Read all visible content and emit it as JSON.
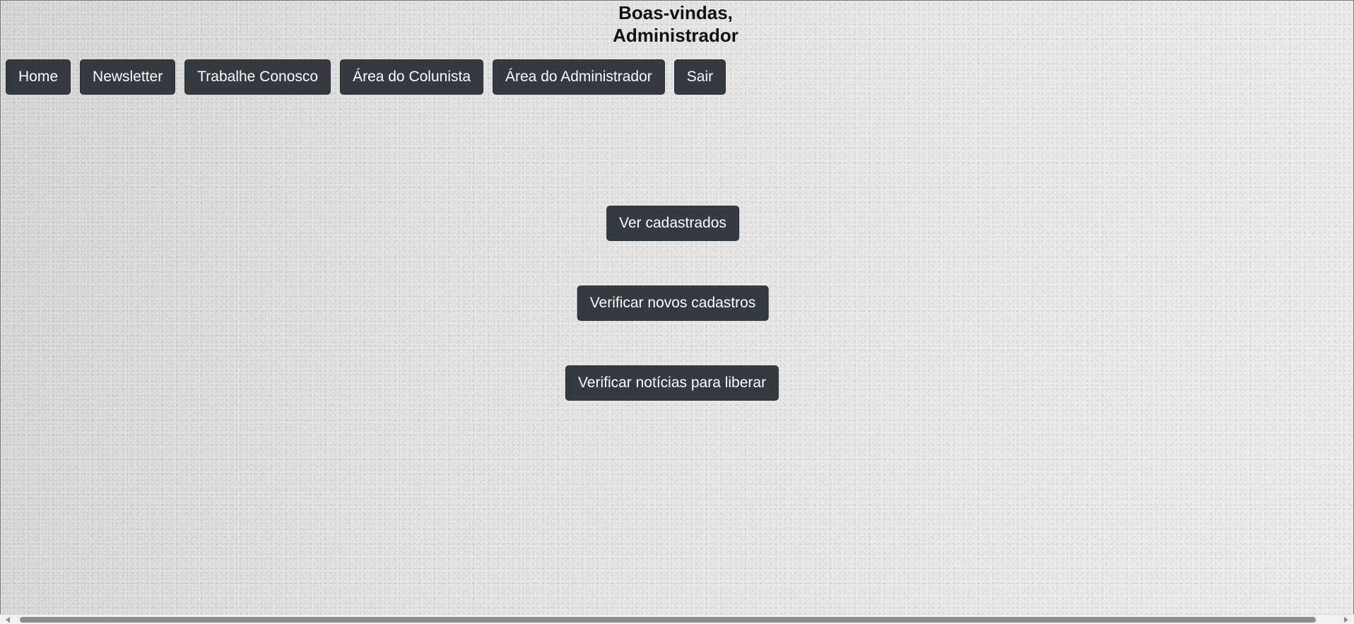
{
  "header": {
    "welcome_line1": "Boas-vindas,",
    "welcome_line2": "Administrador"
  },
  "nav": {
    "items": [
      {
        "label": "Home"
      },
      {
        "label": "Newsletter"
      },
      {
        "label": "Trabalhe Conosco"
      },
      {
        "label": "Área do Colunista"
      },
      {
        "label": "Área do Administrador"
      },
      {
        "label": "Sair"
      }
    ]
  },
  "actions": {
    "view_registered": "Ver cadastrados",
    "verify_new_registrations": "Verificar novos cadastros",
    "verify_news_release": "Verificar notícias para liberar"
  },
  "colors": {
    "button_bg": "#343a40",
    "button_text": "#ffffff",
    "page_bg": "#d9d9d9"
  }
}
